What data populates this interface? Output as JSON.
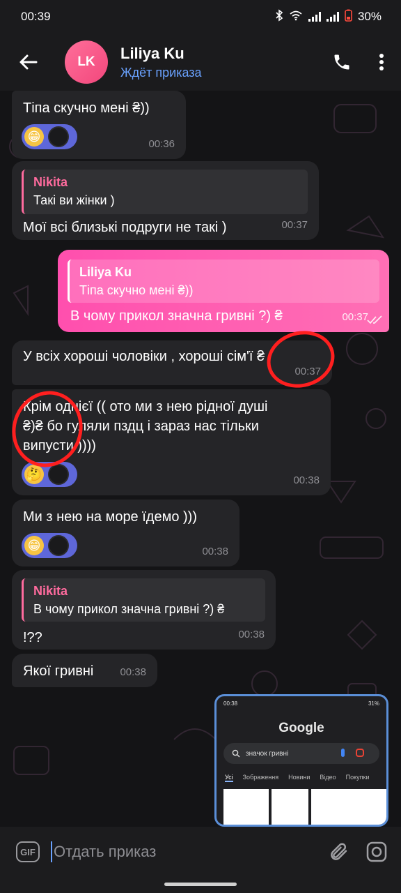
{
  "status": {
    "time": "00:39",
    "battery": "30%"
  },
  "header": {
    "avatar_initials": "LK",
    "name": "Liliya Ku",
    "status": "Ждёт приказа"
  },
  "messages": [
    {
      "text": "Тіпа скучно мені ₴))",
      "time": "00:36",
      "reaction": "😁"
    },
    {
      "reply_name": "Nikita",
      "reply_text": "Такі ви жінки )",
      "text": "Мої всі близькі подруги не такі )",
      "time": "00:37"
    },
    {
      "reply_name": "Liliya Ku",
      "reply_text": "Тіпа скучно мені ₴))",
      "text": "В чому прикол значна гривні ?) ₴",
      "time": "00:37"
    },
    {
      "text": "У всіх хороші чоловіки , хороші сім'ї ₴",
      "time": "00:37"
    },
    {
      "text_line1": "Крім однієї (( ото ми з нею рідної душі",
      "text_line2": "₴)₴ бо гуляли пздц і зараз нас тільки",
      "text_line3": "випусти ))))",
      "time": "00:38",
      "reaction": "🤔"
    },
    {
      "text": "Ми з нею на море їдемо )))",
      "time": "00:38",
      "reaction": "😁"
    },
    {
      "reply_name": "Nikita",
      "reply_text": "В чому прикол значна гривні ?) ₴",
      "text": "!??",
      "time": "00:38"
    },
    {
      "text": "Якої гривні",
      "time": "00:38"
    }
  ],
  "image_preview": {
    "status_time": "00:38",
    "status_battery": "31%",
    "google": "Google",
    "search_query": "значок гривні",
    "tabs": [
      "Усі",
      "Зображення",
      "Новини",
      "Відео",
      "Покупки"
    ]
  },
  "input": {
    "gif_label": "GIF",
    "placeholder": "Отдать приказ"
  },
  "colors": {
    "accent_blue": "#6aa2ff",
    "outgoing_pink": "#ff4fae",
    "reply_pink": "#ff6b9e",
    "annotation_red": "#ff1f1f"
  }
}
